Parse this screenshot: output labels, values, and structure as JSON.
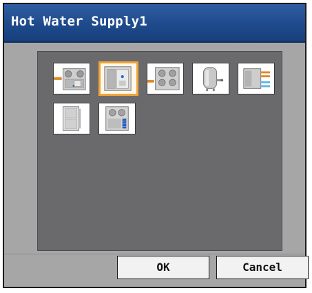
{
  "dialog": {
    "title": "Hot Water Supply1"
  },
  "icons": [
    {
      "name": "hot-water-unit-with-pipe-icon",
      "selected": false
    },
    {
      "name": "hot-water-heat-pump-unit-icon",
      "selected": true
    },
    {
      "name": "hot-water-unit-twin-icon",
      "selected": false
    },
    {
      "name": "hot-water-storage-tank-icon",
      "selected": false
    },
    {
      "name": "water-heat-exchanger-icon",
      "selected": false
    },
    {
      "name": "indoor-cabinet-unit-icon",
      "selected": false
    },
    {
      "name": "outdoor-hot-water-unit-icon",
      "selected": false
    }
  ],
  "buttons": {
    "ok": "OK",
    "cancel": "Cancel"
  },
  "colors": {
    "title_bar": "#1e4a8c",
    "panel_bg": "#6a6a6c",
    "selection_border": "#f0a53a",
    "dialog_bg": "#a6a6a6"
  }
}
